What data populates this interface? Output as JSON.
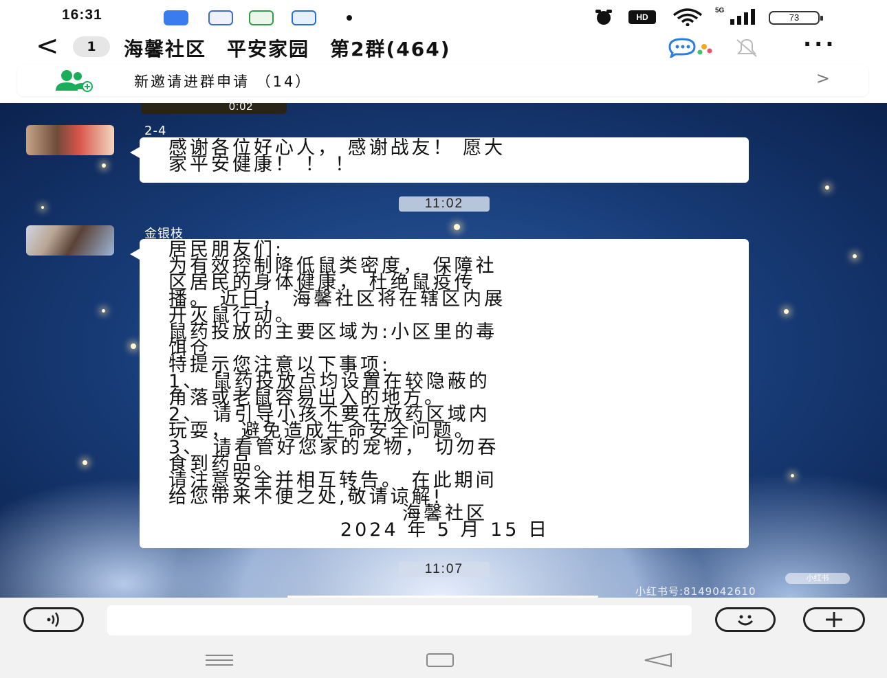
{
  "status_bar": {
    "time": "16:31",
    "battery": "73",
    "hd_label": "HD",
    "network_label": "5G"
  },
  "header": {
    "back_symbol": "<",
    "unread_count": "1",
    "title": "海馨社区　平安家园　第2群(464)",
    "more_symbol": "···"
  },
  "invite_banner": {
    "text": "新邀请进群申请 （14）",
    "chevron": ">"
  },
  "messages": [
    {
      "video_duration": "0:02"
    },
    {
      "sender": "2-4",
      "lines": [
        "感谢各位好心人， 感谢战友！ 愿大",
        "家平安健康！ ！ ！"
      ]
    },
    {
      "timestamp": "11:02"
    },
    {
      "sender": "金银枝",
      "lines": [
        "居民朋友们:",
        "为有效控制降低鼠类密度， 保障社",
        "区居民的身体健康， 杜绝鼠疫传",
        "播。 近日， 海馨社区将在辖区内展",
        "开灭鼠行动。",
        "鼠药投放的主要区域为:小区里的毒",
        "饵仓",
        "特提示您注意以下事项:",
        "1、 鼠药投放点均设置在较隐蔽的",
        "角落或老鼠容易出入的地方。",
        "2、 请引导小孩不要在放药区域内",
        "玩耍， 避免造成生命安全问题。",
        "3、 请看管好您家的宠物， 切勿吞",
        "食到药品。",
        "请注意安全并相互转告。 在此期间",
        "给您带来不便之处,敬请谅解!"
      ],
      "signature": "海馨社区",
      "date": "2024 年 5 月 15 日"
    },
    {
      "timestamp": "11:07"
    }
  ],
  "watermark": {
    "badge": "小红书",
    "text": "小红书号:8149042610"
  },
  "input": {
    "value": "",
    "placeholder": ""
  },
  "colors": {
    "chat_bg_dark": "#173a75",
    "bubble": "#ffffff",
    "invite_green": "#1aad5a"
  }
}
